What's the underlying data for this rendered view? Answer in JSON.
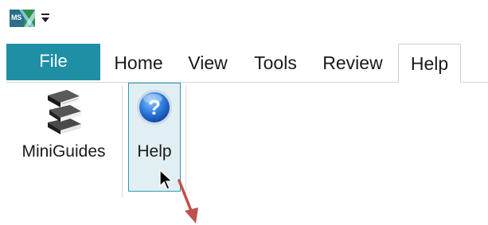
{
  "app": {
    "logo_text": "MS",
    "qat_dropdown_icon": "caret-down-icon"
  },
  "tabs": {
    "file": "File",
    "items": [
      "Home",
      "View",
      "Tools",
      "Review",
      "Help"
    ],
    "active": "Help"
  },
  "ribbon": {
    "miniguides": {
      "label": "MiniGuides",
      "icon": "books-icon"
    },
    "help": {
      "label": "Help",
      "icon": "help-question-icon"
    }
  },
  "colors": {
    "file_tab": "#1f8fa6",
    "help_highlight_bg": "#e1eff2",
    "help_highlight_border": "#2f97b5",
    "annotation_arrow": "#c0504d"
  }
}
